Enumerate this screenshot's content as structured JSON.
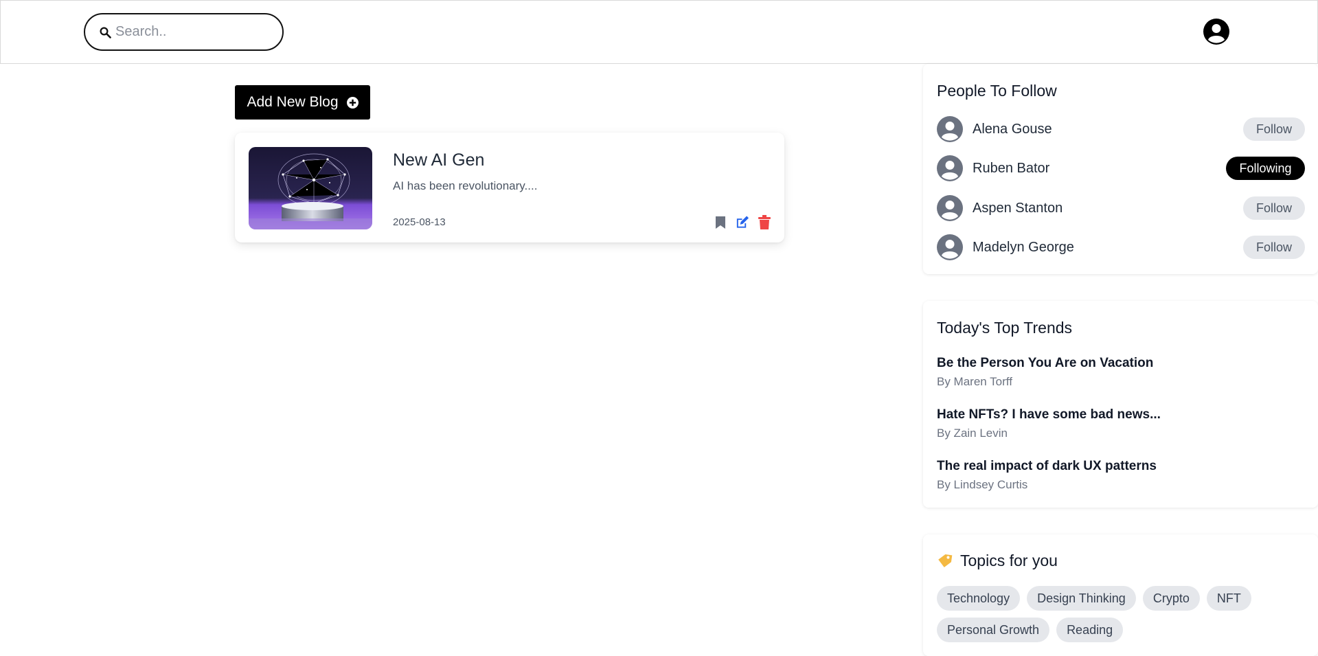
{
  "header": {
    "search_placeholder": "Search.."
  },
  "main": {
    "add_blog_label": "Add New Blog",
    "blogs": [
      {
        "title": "New AI Gen",
        "excerpt": "AI has been revolutionary....",
        "date": "2025-08-13"
      }
    ]
  },
  "sidebar": {
    "follow": {
      "title": "People To Follow",
      "people": [
        {
          "name": "Alena Gouse",
          "status": "Follow"
        },
        {
          "name": "Ruben Bator",
          "status": "Following"
        },
        {
          "name": "Aspen Stanton",
          "status": "Follow"
        },
        {
          "name": "Madelyn George",
          "status": "Follow"
        }
      ]
    },
    "trends": {
      "title": "Today's Top Trends",
      "items": [
        {
          "title": "Be the Person You Are on Vacation",
          "author": "By Maren Torff"
        },
        {
          "title": "Hate NFTs? I have some bad news...",
          "author": "By Zain Levin"
        },
        {
          "title": "The real impact of dark UX patterns",
          "author": "By Lindsey Curtis"
        }
      ]
    },
    "topics": {
      "title": "Topics for you",
      "tags": [
        "Technology",
        "Design Thinking",
        "Crypto",
        "NFT",
        "Personal Growth",
        "Reading"
      ]
    }
  },
  "colors": {
    "primary": "#000000",
    "edit_icon": "#2563eb",
    "delete_icon": "#ef4444",
    "bookmark_icon": "#6b7280",
    "pill_bg": "#e5e7eb",
    "muted_text": "#6b7280"
  },
  "icons": {
    "search": "search-icon",
    "profile": "user-circle-icon",
    "add": "plus-circle-icon",
    "bookmark": "bookmark-icon",
    "edit": "edit-icon",
    "delete": "trash-icon",
    "avatar": "user-circle-icon",
    "topics": "tag-icon"
  }
}
